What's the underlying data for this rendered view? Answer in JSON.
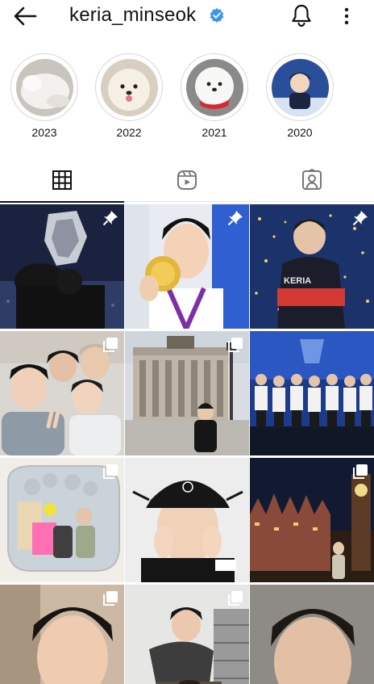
{
  "header": {
    "username": "keria_minseok",
    "back_icon": "arrow-left-icon",
    "verified_icon": "verified-badge-icon",
    "notifications_icon": "bell-icon",
    "more_icon": "more-vertical-icon"
  },
  "highlights": [
    {
      "label": "2023"
    },
    {
      "label": "2022"
    },
    {
      "label": "2021"
    },
    {
      "label": "2020"
    }
  ],
  "tabs": [
    {
      "name": "posts-grid",
      "icon": "grid-icon",
      "active": true
    },
    {
      "name": "reels",
      "icon": "reels-icon",
      "active": false
    },
    {
      "name": "tagged",
      "icon": "tagged-person-icon",
      "active": false
    }
  ],
  "grid": {
    "posts": [
      {
        "badge": "pinned-icon"
      },
      {
        "badge": "pinned-icon"
      },
      {
        "badge": "pinned-icon"
      },
      {
        "badge": "carousel-icon"
      },
      {
        "badge": "carousel-icon"
      },
      {
        "badge": "none"
      },
      {
        "badge": "carousel-icon"
      },
      {
        "badge": "none"
      },
      {
        "badge": "carousel-icon"
      },
      {
        "badge": "carousel-icon"
      },
      {
        "badge": "carousel-icon"
      },
      {
        "badge": "none"
      }
    ]
  },
  "colors": {
    "text": "#111111",
    "verified": "#3897f0",
    "divider": "#e6e6e6",
    "ring": "#d7d7d7"
  }
}
